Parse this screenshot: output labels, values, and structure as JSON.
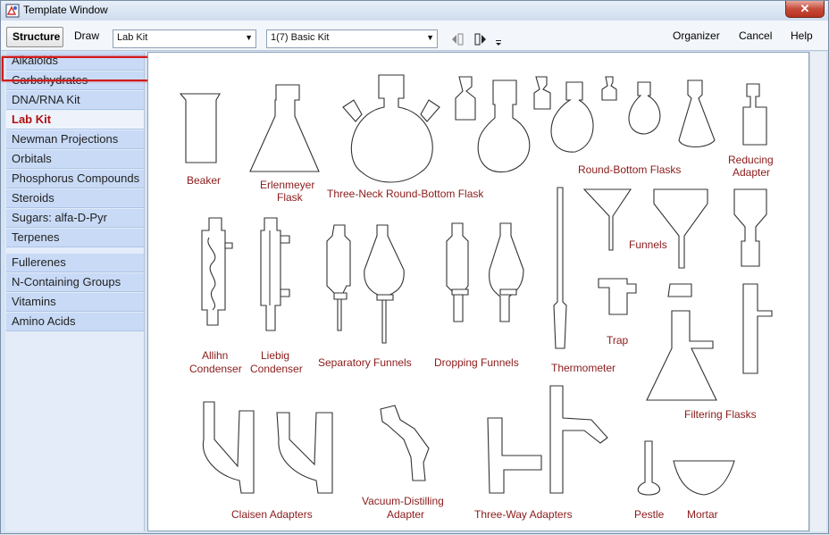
{
  "window": {
    "title": "Template Window",
    "close_glyph": "✕"
  },
  "toolbar": {
    "structure": "Structure",
    "draw": "Draw",
    "combo_category": "Lab Kit",
    "combo_page": "1(7) Basic Kit",
    "organizer": "Organizer",
    "cancel": "Cancel",
    "help": "Help"
  },
  "sidebar": {
    "items": [
      {
        "label": "Alkaloids"
      },
      {
        "label": "Carbohydrates"
      },
      {
        "label": "DNA/RNA Kit"
      },
      {
        "label": "Lab Kit"
      },
      {
        "label": "Newman Projections"
      },
      {
        "label": "Orbitals"
      },
      {
        "label": "Phosphorus Compounds"
      },
      {
        "label": "Steroids"
      },
      {
        "label": "Sugars: alfa-D-Pyr"
      },
      {
        "label": "Terpenes"
      },
      {
        "label": "Fullerenes"
      },
      {
        "label": "N-Containing Groups"
      },
      {
        "label": "Vitamins"
      },
      {
        "label": "Amino Acids"
      }
    ]
  },
  "labels": {
    "beaker": "Beaker",
    "erlen1": "Erlenmeyer",
    "erlen2": "Flask",
    "threeneck": "Three-Neck Round-Bottom Flask",
    "roundbottom": "Round-Bottom Flasks",
    "reducing1": "Reducing",
    "reducing2": "Adapter",
    "allihn1": "Allihn",
    "allihn2": "Condenser",
    "liebig1": "Liebig",
    "liebig2": "Condenser",
    "sepfunnels": "Separatory Funnels",
    "dropfunnels": "Dropping Funnels",
    "thermo": "Thermometer",
    "funnels": "Funnels",
    "trap": "Trap",
    "filtering": "Filtering Flasks",
    "claisen": "Claisen Adapters",
    "vacuum1": "Vacuum-Distilling",
    "vacuum2": "Adapter",
    "threeway": "Three-Way Adapters",
    "pestle": "Pestle",
    "mortar": "Mortar"
  }
}
